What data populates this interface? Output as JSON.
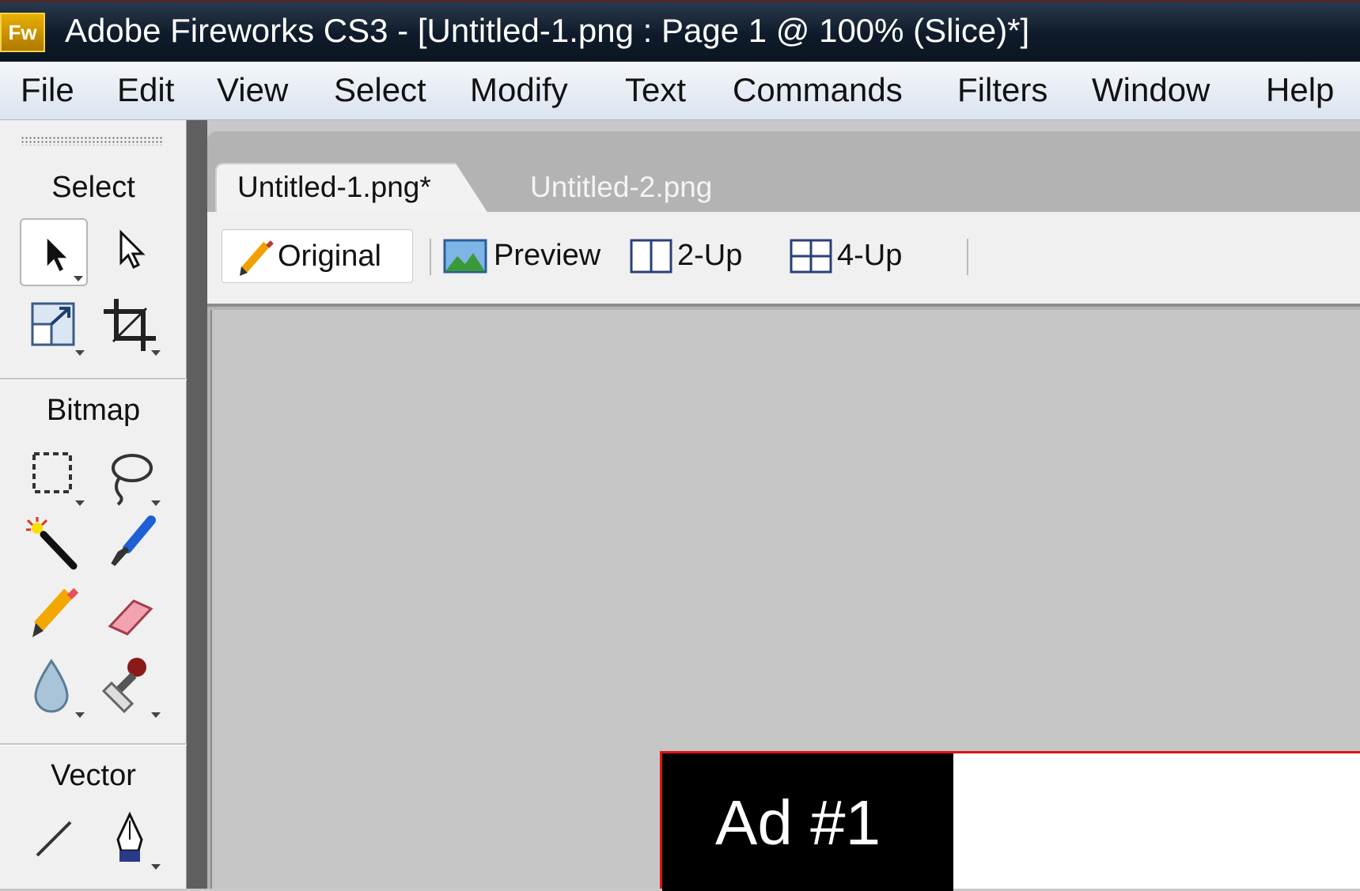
{
  "window": {
    "app_icon": "Fw",
    "title": "Adobe Fireworks CS3 - [Untitled-1.png : Page 1 @ 100% (Slice)*]"
  },
  "menu": {
    "items": [
      {
        "label": "File"
      },
      {
        "label": "Edit"
      },
      {
        "label": "View"
      },
      {
        "label": "Select"
      },
      {
        "label": "Modify"
      },
      {
        "label": "Text"
      },
      {
        "label": "Commands"
      },
      {
        "label": "Filters"
      },
      {
        "label": "Window"
      },
      {
        "label": "Help"
      }
    ]
  },
  "tools": {
    "sections": [
      {
        "label": "Select",
        "tools": [
          "pointer-icon",
          "subselection-icon",
          "scale-icon",
          "crop-icon"
        ]
      },
      {
        "label": "Bitmap",
        "tools": [
          "marquee-icon",
          "lasso-icon",
          "magic-wand-icon",
          "brush-icon",
          "pencil-icon",
          "eraser-icon",
          "blur-icon",
          "rubber-stamp-icon"
        ]
      },
      {
        "label": "Vector",
        "tools": [
          "line-icon",
          "pen-icon"
        ]
      }
    ]
  },
  "document": {
    "tabs": [
      {
        "label": "Untitled-1.png*",
        "active": true
      },
      {
        "label": "Untitled-2.png",
        "active": false
      }
    ],
    "views": [
      {
        "label": "Original",
        "icon": "pencil-icon",
        "active": true
      },
      {
        "label": "Preview",
        "icon": "landscape-icon",
        "active": false
      },
      {
        "label": "2-Up",
        "icon": "two-up-icon",
        "active": false
      },
      {
        "label": "4-Up",
        "icon": "four-up-icon",
        "active": false
      }
    ],
    "canvas": {
      "ad_label": "Ad #1"
    }
  },
  "colors": {
    "title_bar": "#0f1b2a",
    "slice_border": "#e0140f",
    "canvas_bg": "#c6c6c6"
  }
}
